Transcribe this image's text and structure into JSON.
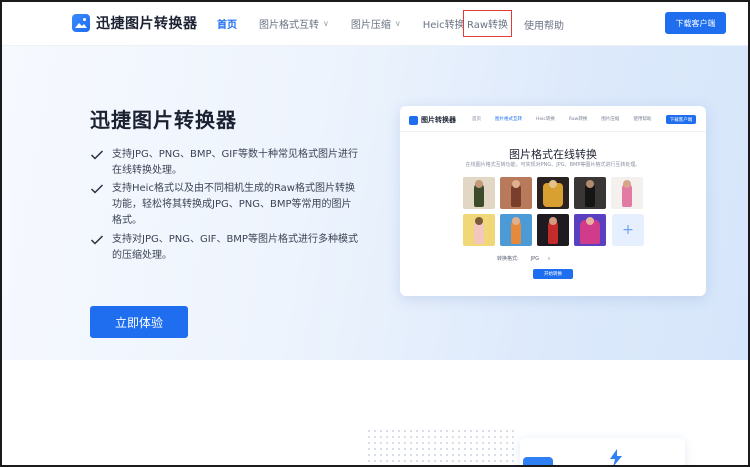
{
  "nav": {
    "brand": "迅捷图片转换器",
    "items": [
      {
        "label": "首页",
        "active": true
      },
      {
        "label": "图片格式互转",
        "dropdown": true
      },
      {
        "label": "图片压缩",
        "dropdown": true
      },
      {
        "label": "Heic转换"
      }
    ],
    "raw_label": "Raw转换",
    "help_label": "使用帮助",
    "download_label": "下载客户端"
  },
  "hero": {
    "title": "迅捷图片转换器",
    "features": [
      "支持JPG、PNG、BMP、GIF等数十种常见格式图片进行在线转换处理。",
      "支持Heic格式以及由不同相机生成的Raw格式图片转换功能，轻松将其转换成JPG、PNG、BMP等常用的图片格式。",
      "支持对JPG、PNG、GIF、BMP等图片格式进行多种模式的压缩处理。"
    ],
    "cta_label": "立即体验"
  },
  "preview": {
    "brand": "图片转换器",
    "menu": [
      "首页",
      "图片格式互转",
      "Heic转换",
      "Raw转换",
      "图片压缩",
      "使用帮助"
    ],
    "download_label": "下载客户端",
    "title": "图片格式在线转换",
    "subtitle": "在线图片格式互转功能，可实现对PNG、JPG、BMP等图片格式进行互转处理。",
    "plus": "+",
    "format_label": "转换格式:",
    "format_value": "JPG",
    "convert_label": "开始转换"
  },
  "colors": {
    "accent": "#1f6ef0",
    "highlight_box": "#e23b3b"
  }
}
